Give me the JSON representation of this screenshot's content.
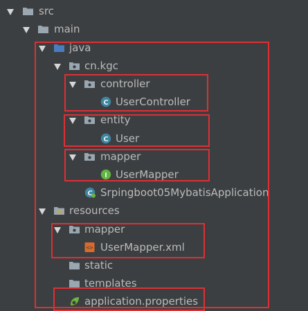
{
  "tree": {
    "src": "src",
    "main": "main",
    "java": "java",
    "cn_kgc": "cn.kgc",
    "controller": "controller",
    "user_controller": "UserController",
    "entity": "entity",
    "user": "User",
    "mapper_pkg": "mapper",
    "user_mapper": "UserMapper",
    "app_class": "Srpingboot05MybatisApplication",
    "resources": "resources",
    "mapper_dir": "mapper",
    "user_mapper_xml": "UserMapper.xml",
    "static": "static",
    "templates": "templates",
    "app_properties": "application.properties"
  },
  "icons": {
    "folder": "folder-icon",
    "source_root": "source-root-folder-icon",
    "package": "package-icon",
    "class": "class-icon",
    "interface": "interface-icon",
    "spring_boot_app": "spring-boot-class-icon",
    "resources_root": "resources-root-icon",
    "xml_file": "xml-file-icon",
    "spring_properties": "spring-properties-icon"
  },
  "colors": {
    "background": "#3c3f41",
    "text": "#bbbbbb",
    "highlight_box": "#e02f33",
    "class_icon": "#3e86a0",
    "interface_icon": "#62b543",
    "source_root_blue": "#4a7cc2"
  }
}
